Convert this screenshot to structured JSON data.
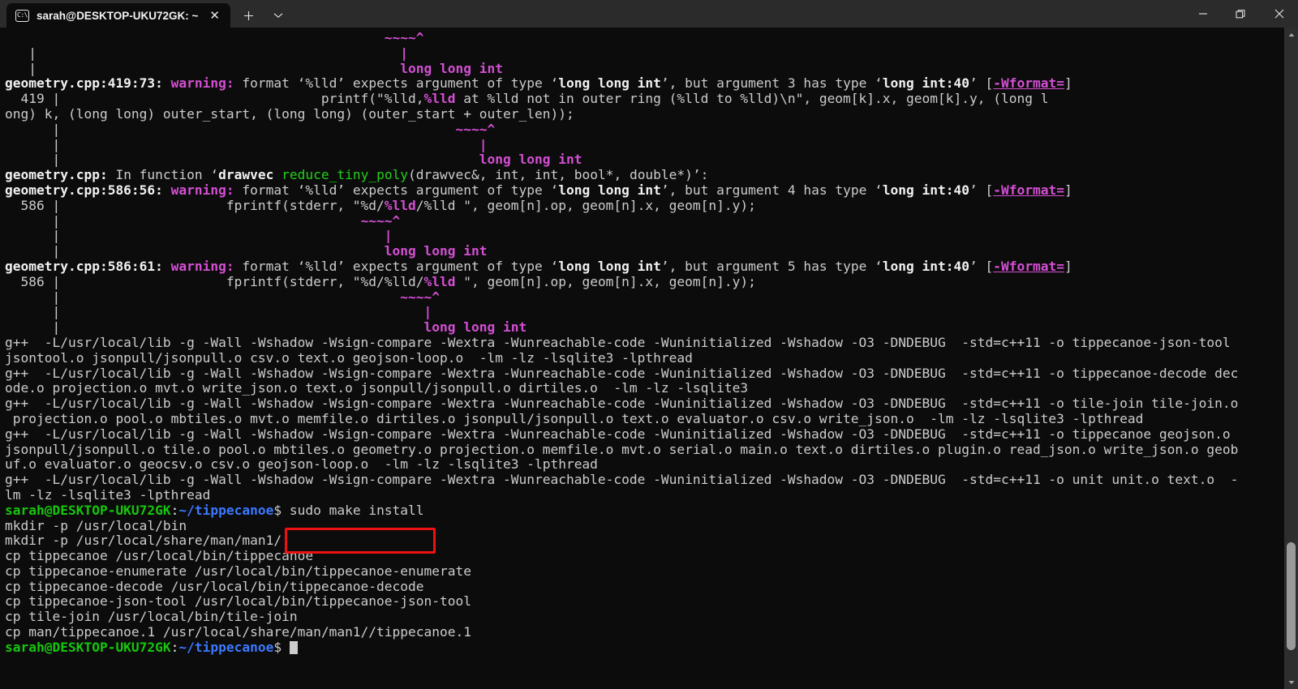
{
  "window": {
    "tab": {
      "icon": "console-icon",
      "icon_glyph": "C:\\",
      "title": "sarah@DESKTOP-UKU72GK: ~",
      "close_glyph": "✕"
    },
    "new_tab_glyph": "+",
    "tab_menu_glyph": "⌄",
    "controls": {
      "minimize": "minimize-icon",
      "maximize": "restore-icon",
      "close": "close-icon"
    }
  },
  "annotation": {
    "color": "#ee1111",
    "target_text": "sudo make install"
  },
  "colors": {
    "background": "#0c0c0c",
    "foreground": "#cccccc",
    "magenta": "#d44fd4",
    "green": "#16c60c",
    "blue": "#3b78ff",
    "titlebar": "#2b2b2b"
  },
  "scrollbar": {
    "up_glyph": "▲",
    "down_glyph": "▼",
    "thumb_top_pct": 79,
    "thumb_height_pct": 17
  },
  "terminal": {
    "prompt_user": "sarah@DESKTOP-UKU72GK",
    "prompt_path": "~/tippecanoe",
    "command": "sudo make install",
    "lines": [
      [
        {
          "t": "                                                ",
          "c": "c-dim"
        },
        {
          "t": "~~~~^",
          "c": "c-mag"
        }
      ],
      [
        {
          "t": "   |",
          "c": "c-dim"
        },
        {
          "t": "                                              |",
          "c": "c-mag"
        }
      ],
      [
        {
          "t": "   |",
          "c": "c-dim"
        },
        {
          "t": "                                              long long int",
          "c": "c-mag"
        }
      ],
      [
        {
          "t": "geometry.cpp:419:73:",
          "c": "c-bold"
        },
        {
          "t": " ",
          "c": "c-dim"
        },
        {
          "t": "warning:",
          "c": "c-mag"
        },
        {
          "t": " format ‘%lld’ expects argument of type ‘",
          "c": "c-dim"
        },
        {
          "t": "long long int",
          "c": "c-bold"
        },
        {
          "t": "’, but argument 3 has type ‘",
          "c": "c-dim"
        },
        {
          "t": "long int:40",
          "c": "c-bold"
        },
        {
          "t": "’ [",
          "c": "c-dim"
        },
        {
          "t": "-Wformat=",
          "c": "c-mag-u"
        },
        {
          "t": "]",
          "c": "c-dim"
        }
      ],
      [
        {
          "t": "  419 |                                 printf(\"%lld,",
          "c": "c-dim"
        },
        {
          "t": "%lld",
          "c": "c-mag"
        },
        {
          "t": " at %lld not in outer ring (%lld to %lld)\\n\", geom[k].x, geom[k].y, (long l",
          "c": "c-dim"
        }
      ],
      [
        {
          "t": "ong) k, (long long) outer_start, (long long) (outer_start + outer_len));",
          "c": "c-dim"
        }
      ],
      [
        {
          "t": "      |                                                  ",
          "c": "c-dim"
        },
        {
          "t": "~~~~^",
          "c": "c-mag"
        }
      ],
      [
        {
          "t": "      |                                                     ",
          "c": "c-dim"
        },
        {
          "t": "|",
          "c": "c-mag"
        }
      ],
      [
        {
          "t": "      |                                                     ",
          "c": "c-dim"
        },
        {
          "t": "long long int",
          "c": "c-mag"
        }
      ],
      [
        {
          "t": "geometry.cpp:",
          "c": "c-bold"
        },
        {
          "t": " In function ‘",
          "c": "c-dim"
        },
        {
          "t": "drawvec ",
          "c": "c-bold"
        },
        {
          "t": "reduce_tiny_poly",
          "c": "c-greenf"
        },
        {
          "t": "(drawvec&, int, int, bool*, double*)’:",
          "c": "c-dim"
        }
      ],
      [
        {
          "t": "geometry.cpp:586:56:",
          "c": "c-bold"
        },
        {
          "t": " ",
          "c": "c-dim"
        },
        {
          "t": "warning:",
          "c": "c-mag"
        },
        {
          "t": " format ‘%lld’ expects argument of type ‘",
          "c": "c-dim"
        },
        {
          "t": "long long int",
          "c": "c-bold"
        },
        {
          "t": "’, but argument 4 has type ‘",
          "c": "c-dim"
        },
        {
          "t": "long int:40",
          "c": "c-bold"
        },
        {
          "t": "’ [",
          "c": "c-dim"
        },
        {
          "t": "-Wformat=",
          "c": "c-mag-u"
        },
        {
          "t": "]",
          "c": "c-dim"
        }
      ],
      [
        {
          "t": "  586 |                     fprintf(stderr, \"%d/",
          "c": "c-dim"
        },
        {
          "t": "%lld",
          "c": "c-mag"
        },
        {
          "t": "/%lld \", geom[n].op, geom[n].x, geom[n].y);",
          "c": "c-dim"
        }
      ],
      [
        {
          "t": "      |                                      ",
          "c": "c-dim"
        },
        {
          "t": "~~~~^",
          "c": "c-mag"
        }
      ],
      [
        {
          "t": "      |                                         ",
          "c": "c-dim"
        },
        {
          "t": "|",
          "c": "c-mag"
        }
      ],
      [
        {
          "t": "      |                                         ",
          "c": "c-dim"
        },
        {
          "t": "long long int",
          "c": "c-mag"
        }
      ],
      [
        {
          "t": "geometry.cpp:586:61:",
          "c": "c-bold"
        },
        {
          "t": " ",
          "c": "c-dim"
        },
        {
          "t": "warning:",
          "c": "c-mag"
        },
        {
          "t": " format ‘%lld’ expects argument of type ‘",
          "c": "c-dim"
        },
        {
          "t": "long long int",
          "c": "c-bold"
        },
        {
          "t": "’, but argument 5 has type ‘",
          "c": "c-dim"
        },
        {
          "t": "long int:40",
          "c": "c-bold"
        },
        {
          "t": "’ [",
          "c": "c-dim"
        },
        {
          "t": "-Wformat=",
          "c": "c-mag-u"
        },
        {
          "t": "]",
          "c": "c-dim"
        }
      ],
      [
        {
          "t": "  586 |                     fprintf(stderr, \"%d/%lld/",
          "c": "c-dim"
        },
        {
          "t": "%lld",
          "c": "c-mag"
        },
        {
          "t": " \", geom[n].op, geom[n].x, geom[n].y);",
          "c": "c-dim"
        }
      ],
      [
        {
          "t": "      |                                           ",
          "c": "c-dim"
        },
        {
          "t": "~~~~^",
          "c": "c-mag"
        }
      ],
      [
        {
          "t": "      |                                              ",
          "c": "c-dim"
        },
        {
          "t": "|",
          "c": "c-mag"
        }
      ],
      [
        {
          "t": "      |                                              ",
          "c": "c-dim"
        },
        {
          "t": "long long int",
          "c": "c-mag"
        }
      ],
      [
        {
          "t": "g++  -L/usr/local/lib -g -Wall -Wshadow -Wsign-compare -Wextra -Wunreachable-code -Wuninitialized -Wshadow -O3 -DNDEBUG  -std=c++11 -o tippecanoe-json-tool",
          "c": "c-dim"
        }
      ],
      [
        {
          "t": "jsontool.o jsonpull/jsonpull.o csv.o text.o geojson-loop.o  -lm -lz -lsqlite3 -lpthread",
          "c": "c-dim"
        }
      ],
      [
        {
          "t": "g++  -L/usr/local/lib -g -Wall -Wshadow -Wsign-compare -Wextra -Wunreachable-code -Wuninitialized -Wshadow -O3 -DNDEBUG  -std=c++11 -o tippecanoe-decode dec",
          "c": "c-dim"
        }
      ],
      [
        {
          "t": "ode.o projection.o mvt.o write_json.o text.o jsonpull/jsonpull.o dirtiles.o  -lm -lz -lsqlite3",
          "c": "c-dim"
        }
      ],
      [
        {
          "t": "g++  -L/usr/local/lib -g -Wall -Wshadow -Wsign-compare -Wextra -Wunreachable-code -Wuninitialized -Wshadow -O3 -DNDEBUG  -std=c++11 -o tile-join tile-join.o",
          "c": "c-dim"
        }
      ],
      [
        {
          "t": " projection.o pool.o mbtiles.o mvt.o memfile.o dirtiles.o jsonpull/jsonpull.o text.o evaluator.o csv.o write_json.o  -lm -lz -lsqlite3 -lpthread",
          "c": "c-dim"
        }
      ],
      [
        {
          "t": "g++  -L/usr/local/lib -g -Wall -Wshadow -Wsign-compare -Wextra -Wunreachable-code -Wuninitialized -Wshadow -O3 -DNDEBUG  -std=c++11 -o tippecanoe geojson.o",
          "c": "c-dim"
        }
      ],
      [
        {
          "t": "jsonpull/jsonpull.o tile.o pool.o mbtiles.o geometry.o projection.o memfile.o mvt.o serial.o main.o text.o dirtiles.o plugin.o read_json.o write_json.o geob",
          "c": "c-dim"
        }
      ],
      [
        {
          "t": "uf.o evaluator.o geocsv.o csv.o geojson-loop.o  -lm -lz -lsqlite3 -lpthread",
          "c": "c-dim"
        }
      ],
      [
        {
          "t": "g++  -L/usr/local/lib -g -Wall -Wshadow -Wsign-compare -Wextra -Wunreachable-code -Wuninitialized -Wshadow -O3 -DNDEBUG  -std=c++11 -o unit unit.o text.o  -",
          "c": "c-dim"
        }
      ],
      [
        {
          "t": "lm -lz -lsqlite3 -lpthread",
          "c": "c-dim"
        }
      ],
      [
        {
          "t": "sarah@DESKTOP-UKU72GK",
          "c": "c-green"
        },
        {
          "t": ":",
          "c": "c-white"
        },
        {
          "t": "~/tippecanoe",
          "c": "c-blue"
        },
        {
          "t": "$ sudo make install",
          "c": "c-dim"
        }
      ],
      [
        {
          "t": "mkdir -p /usr/local/bin",
          "c": "c-dim"
        }
      ],
      [
        {
          "t": "mkdir -p /usr/local/share/man/man1/",
          "c": "c-dim"
        }
      ],
      [
        {
          "t": "cp tippecanoe /usr/local/bin/tippecanoe",
          "c": "c-dim"
        }
      ],
      [
        {
          "t": "cp tippecanoe-enumerate /usr/local/bin/tippecanoe-enumerate",
          "c": "c-dim"
        }
      ],
      [
        {
          "t": "cp tippecanoe-decode /usr/local/bin/tippecanoe-decode",
          "c": "c-dim"
        }
      ],
      [
        {
          "t": "cp tippecanoe-json-tool /usr/local/bin/tippecanoe-json-tool",
          "c": "c-dim"
        }
      ],
      [
        {
          "t": "cp tile-join /usr/local/bin/tile-join",
          "c": "c-dim"
        }
      ],
      [
        {
          "t": "cp man/tippecanoe.1 /usr/local/share/man/man1//tippecanoe.1",
          "c": "c-dim"
        }
      ],
      [
        {
          "t": "sarah@DESKTOP-UKU72GK",
          "c": "c-green"
        },
        {
          "t": ":",
          "c": "c-white"
        },
        {
          "t": "~/tippecanoe",
          "c": "c-blue"
        },
        {
          "t": "$ ",
          "c": "c-dim"
        },
        {
          "t": "",
          "c": "cursor-slot"
        }
      ]
    ]
  }
}
